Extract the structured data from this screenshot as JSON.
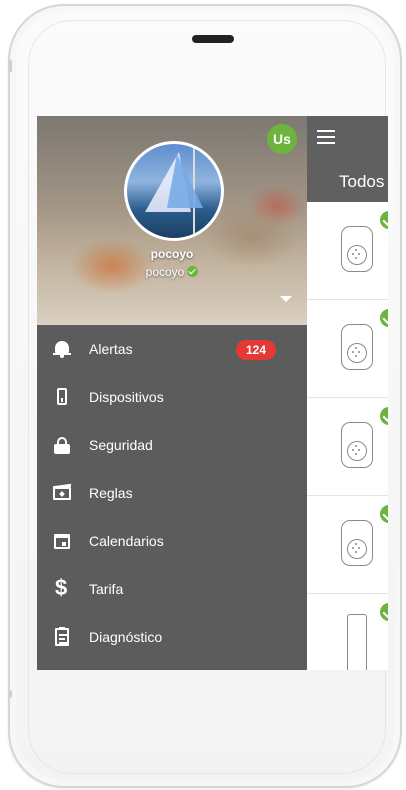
{
  "app_bar": {
    "tab_label": "Todos"
  },
  "profile": {
    "name": "pocoyo",
    "username": "pocoyo",
    "account_badge": "Us"
  },
  "menu": {
    "items": [
      {
        "label": "Alertas",
        "icon": "bell-icon",
        "badge": "124"
      },
      {
        "label": "Dispositivos",
        "icon": "device-icon"
      },
      {
        "label": "Seguridad",
        "icon": "lock-icon"
      },
      {
        "label": "Reglas",
        "icon": "rules-icon"
      },
      {
        "label": "Calendarios",
        "icon": "calendar-icon"
      },
      {
        "label": "Tarifa",
        "icon": "dollar-icon"
      },
      {
        "label": "Diagnóstico",
        "icon": "clipboard-icon"
      }
    ]
  },
  "device_list": {
    "rows": [
      {
        "type": "plug",
        "status": "ok"
      },
      {
        "type": "plug",
        "status": "ok"
      },
      {
        "type": "plug",
        "status": "ok"
      },
      {
        "type": "plug",
        "status": "ok"
      },
      {
        "type": "sensor",
        "status": "ok"
      }
    ]
  },
  "colors": {
    "accent_green": "#6db33f",
    "badge_red": "#e53935",
    "drawer_bg": "#5c5c5c",
    "app_bar_bg": "#606060"
  }
}
